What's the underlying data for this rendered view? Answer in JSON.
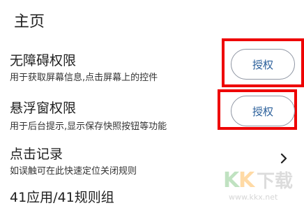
{
  "header": {
    "title": "主页"
  },
  "accessibility": {
    "title": "无障碍权限",
    "desc": "用于获取屏幕信息,点击屏幕上的控件",
    "button": "授权"
  },
  "overlay": {
    "title": "悬浮窗权限",
    "desc": "用于后台提示,显示保存快照按钮等功能",
    "button": "授权"
  },
  "click_log": {
    "title": "点击记录",
    "desc": "如误触可在此快速定位关闭规则",
    "chevron": "chevron-right-icon"
  },
  "stats": {
    "text": "41应用/41规则组"
  },
  "watermark": {
    "logo": "KK下载",
    "url": "www.kkx.net"
  },
  "colors": {
    "highlight": "#ee0000",
    "button_text": "#2a5f9a",
    "button_border": "#8f96a3"
  }
}
